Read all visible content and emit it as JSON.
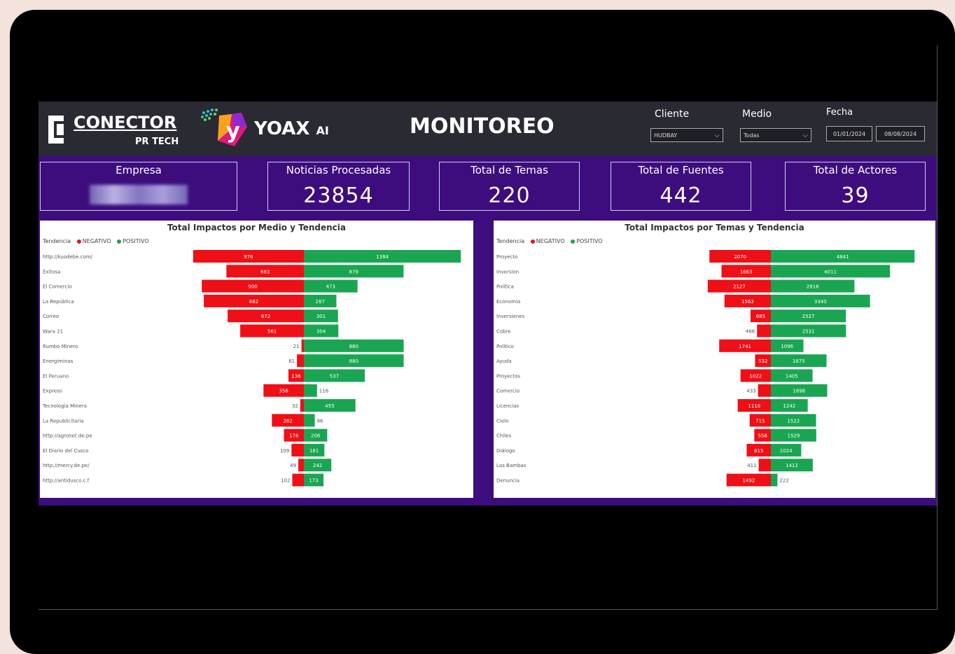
{
  "header": {
    "brand": "CONECTOR",
    "brand_sub": "PR TECH",
    "yoax": "YOAX",
    "yoax_ai": "AI",
    "title": "MONITOREO",
    "filters": {
      "cliente_label": "Cliente",
      "cliente_value": "HUDBAY",
      "medio_label": "Medio",
      "medio_value": "Todas",
      "fecha_label": "Fecha",
      "fecha_start": "01/01/2024",
      "fecha_end": "08/08/2024"
    }
  },
  "kpis": [
    {
      "label": "Empresa",
      "value": ""
    },
    {
      "label": "Noticias Procesadas",
      "value": "23854"
    },
    {
      "label": "Total de Temas",
      "value": "220"
    },
    {
      "label": "Total de Fuentes",
      "value": "442"
    },
    {
      "label": "Total de Actores",
      "value": "39"
    }
  ],
  "colors": {
    "negativo": "#ef0f16",
    "positivo": "#1aa552",
    "dashboard_bg": "#3d0d7e",
    "header_bg": "#2a2a33"
  },
  "chart_data": [
    {
      "type": "bar",
      "title": "Total Impactos por Medio y Tendencia",
      "legend_title": "Tendencia",
      "categories": [
        "http://kuodebe.com/",
        "Exitosa",
        "El Comercio",
        "La República",
        "Correo",
        "Wara 21",
        "Rumbo Minero",
        "Energiminas",
        "El Peruano",
        "Expreso",
        "Tecnología Minera",
        "La Republicitaria",
        "http://agronet.de.pe",
        "El Diario del Cusco",
        "http://mercy.de.pe/",
        "http://antidusco.c.f"
      ],
      "series": [
        {
          "name": "NEGATIVO",
          "values": [
            976,
            683,
            900,
            882,
            672,
            561,
            21,
            61,
            136,
            356,
            32,
            282,
            176,
            109,
            49,
            102
          ]
        },
        {
          "name": "POSITIVO",
          "values": [
            1384,
            879,
            473,
            287,
            301,
            304,
            880,
            880,
            537,
            116,
            455,
            96,
            206,
            181,
            242,
            173
          ]
        }
      ]
    },
    {
      "type": "bar",
      "title": "Total Impactos por Temas y Tendencia",
      "legend_title": "Tendencia",
      "categories": [
        "Proyecto",
        "Inversion",
        "Política",
        "Economía",
        "Inversiones",
        "Cobre",
        "Político",
        "Ayuda",
        "Proyectos",
        "Comercio",
        "Licencias",
        "Cielo",
        "Chiles",
        "Diálogo",
        "Las Bambas",
        "Denuncia"
      ],
      "series": [
        {
          "name": "NEGATIVO",
          "values": [
            2070,
            1663,
            2127,
            1563,
            685,
            466,
            1741,
            532,
            1022,
            433,
            1118,
            715,
            558,
            815,
            411,
            1492
          ]
        },
        {
          "name": "POSITIVO",
          "values": [
            4841,
            4011,
            2816,
            3340,
            2527,
            2531,
            1096,
            1875,
            1405,
            1898,
            1242,
            1522,
            1529,
            1024,
            1412,
            222
          ]
        }
      ]
    }
  ]
}
